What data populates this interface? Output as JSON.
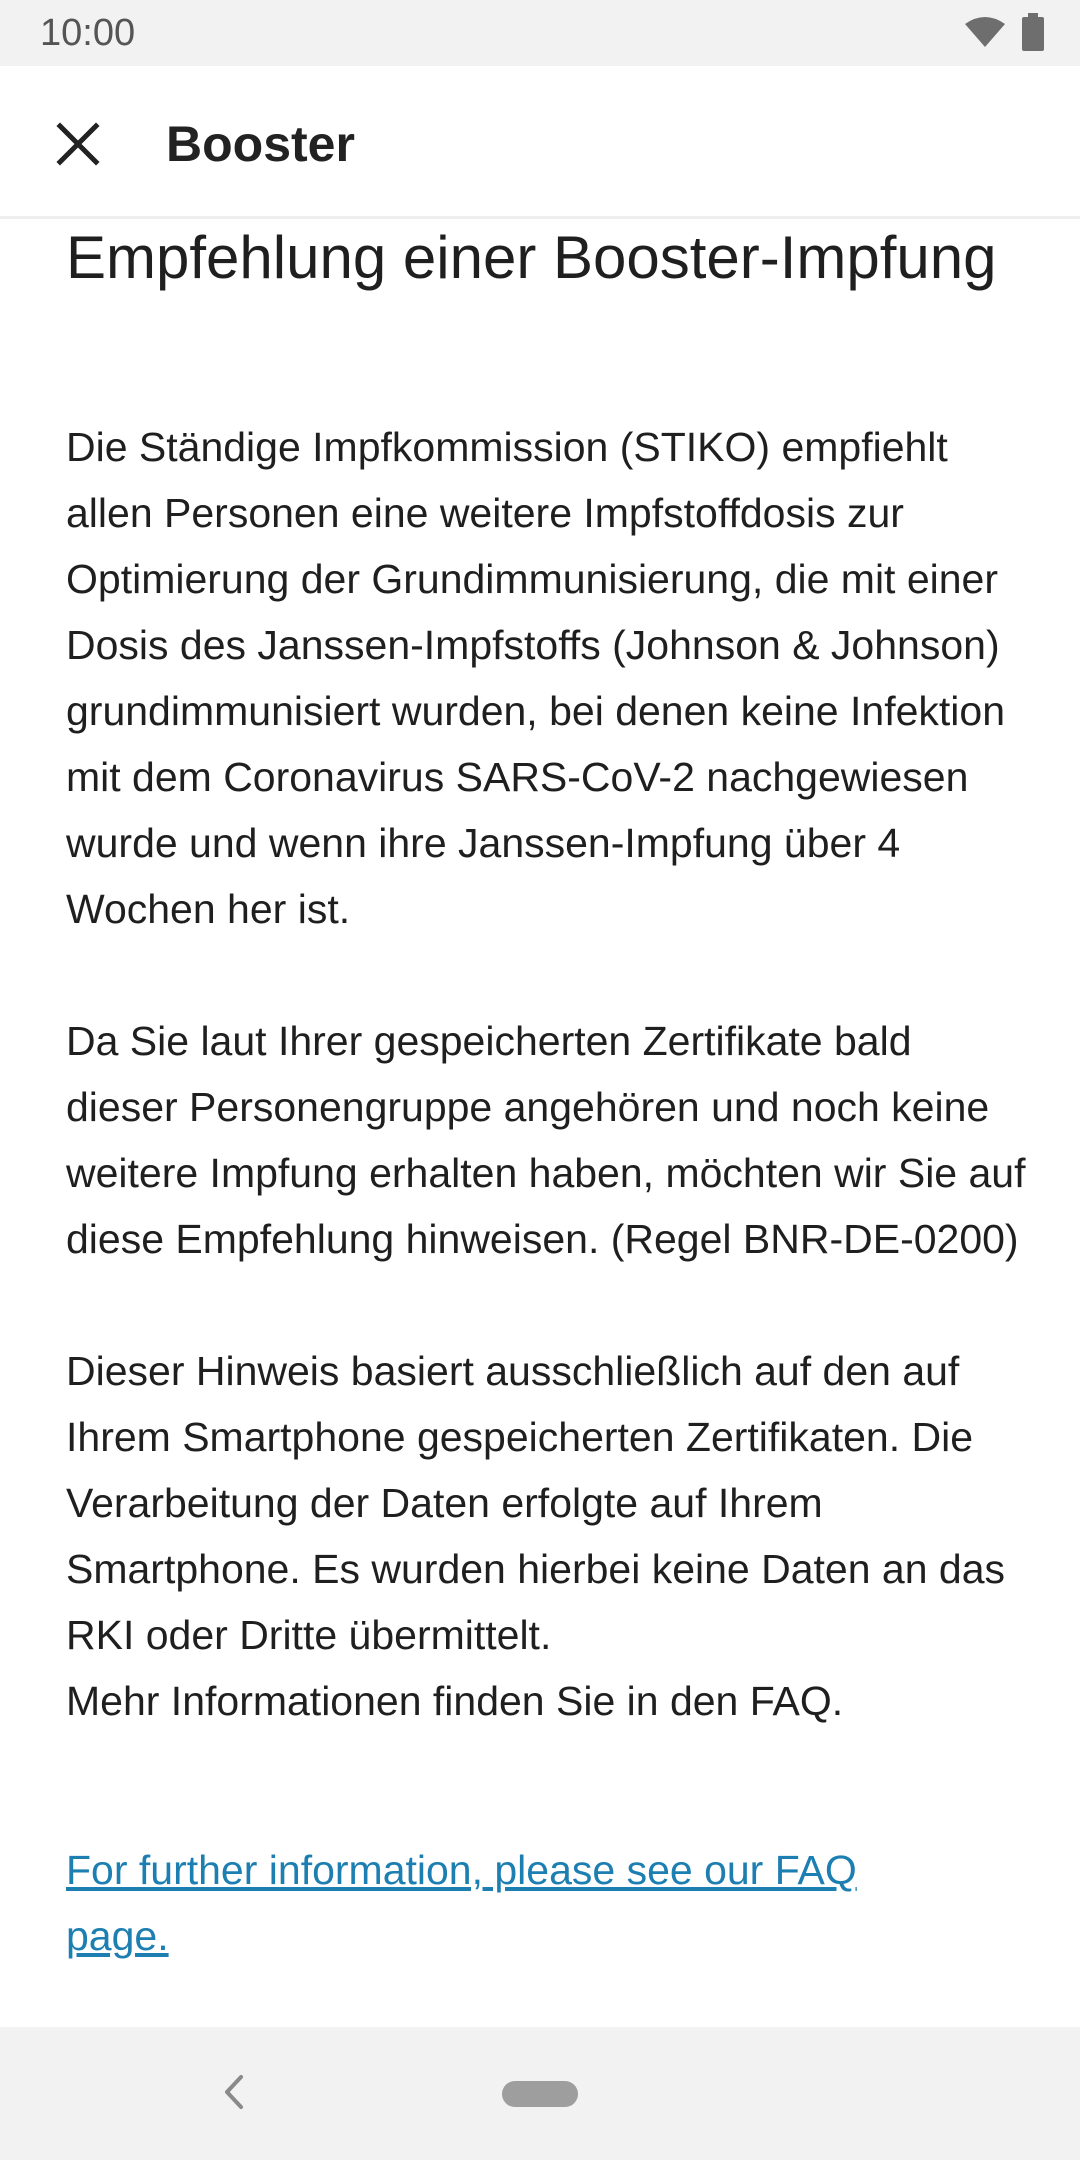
{
  "status_bar": {
    "time": "10:00",
    "icons": [
      "wifi-icon",
      "battery-icon"
    ]
  },
  "app_bar": {
    "close_icon": "close-icon",
    "title": "Booster"
  },
  "content": {
    "headline": "Empfehlung einer Booster-Impfung",
    "body": "Die Ständige Impfkommission (STIKO) empfiehlt allen Personen eine weitere Impfstoffdosis zur Optimierung der Grundimmunisierung, die mit einer Dosis des Janssen-Impfstoffs (Johnson & Johnson) grundimmunisiert wurden, bei denen keine Infektion mit dem Coronavirus SARS-CoV-2 nachgewiesen wurde und wenn ihre Janssen-Impfung über 4 Wochen her ist.\n\n Da Sie laut Ihrer gespeicherten Zertifikate bald dieser Personengruppe angehören und noch keine weitere Impfung erhalten haben, möchten wir Sie auf diese Empfehlung hinweisen. (Regel BNR-DE-0200)\n\n Dieser Hinweis basiert ausschließlich auf den auf Ihrem Smartphone gespeicherten Zertifikaten. Die Verarbeitung der Daten erfolgte auf Ihrem Smartphone. Es wurden hierbei keine Daten an das RKI oder Dritte übermittelt.\nMehr Informationen finden Sie in den FAQ.",
    "faq_link": "For further information, please see our FAQ page."
  },
  "nav_bar": {
    "back_icon": "back-chevron-icon",
    "home_icon": "home-pill-icon"
  },
  "colors": {
    "link": "#1d7fb1",
    "status_bar_bg": "#f2f2f2",
    "text": "#1f1f1f"
  }
}
